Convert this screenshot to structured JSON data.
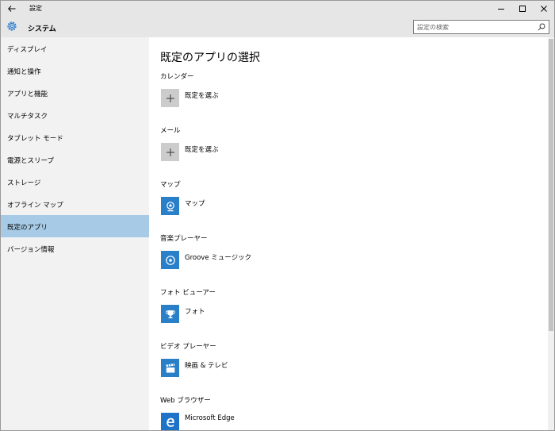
{
  "window": {
    "title": "設定"
  },
  "header": {
    "section_title": "システム",
    "search_placeholder": "設定の検索"
  },
  "sidebar": {
    "items": [
      {
        "label": "ディスプレイ",
        "active": false
      },
      {
        "label": "通知と操作",
        "active": false
      },
      {
        "label": "アプリと機能",
        "active": false
      },
      {
        "label": "マルチタスク",
        "active": false
      },
      {
        "label": "タブレット モード",
        "active": false
      },
      {
        "label": "電源とスリープ",
        "active": false
      },
      {
        "label": "ストレージ",
        "active": false
      },
      {
        "label": "オフライン マップ",
        "active": false
      },
      {
        "label": "既定のアプリ",
        "active": true
      },
      {
        "label": "バージョン情報",
        "active": false
      }
    ]
  },
  "main": {
    "title": "既定のアプリの選択",
    "categories": [
      {
        "label": "カレンダー",
        "app": "既定を選ぶ",
        "icon": "plus-icon"
      },
      {
        "label": "メール",
        "app": "既定を選ぶ",
        "icon": "plus-icon"
      },
      {
        "label": "マップ",
        "app": "マップ",
        "icon": "maps-camera-icon"
      },
      {
        "label": "音楽プレーヤー",
        "app": "Groove ミュージック",
        "icon": "groove-disc-icon"
      },
      {
        "label": "フォト ビューアー",
        "app": "フォト",
        "icon": "photos-trophy-icon"
      },
      {
        "label": "ビデオ プレーヤー",
        "app": "映画 & テレビ",
        "icon": "clapperboard-icon"
      },
      {
        "label": "Web ブラウザー",
        "app": "Microsoft Edge",
        "icon": "edge-icon"
      }
    ]
  },
  "colors": {
    "accent": "#2a7fc9",
    "active_nav": "#a7cbe6",
    "chrome": "#e6e6e6",
    "sidebar": "#f2f2f2"
  }
}
